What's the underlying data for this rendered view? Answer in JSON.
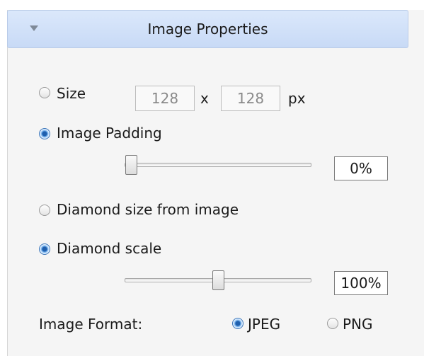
{
  "panel": {
    "title": "Image Properties"
  },
  "size": {
    "label": "Size",
    "selected": false,
    "width": "128",
    "separator": "x",
    "height": "128",
    "unit": "px"
  },
  "image_padding": {
    "label": "Image Padding",
    "selected": true,
    "slider_fraction": 0,
    "value": "0%"
  },
  "diamond_size_from_image": {
    "label": "Diamond size from image",
    "selected": false
  },
  "diamond_scale": {
    "label": "Diamond scale",
    "selected": true,
    "slider_fraction": 0.5,
    "value": "100%"
  },
  "image_format": {
    "label": "Image Format:",
    "options": [
      {
        "label": "JPEG",
        "selected": true
      },
      {
        "label": "PNG",
        "selected": false
      }
    ]
  }
}
